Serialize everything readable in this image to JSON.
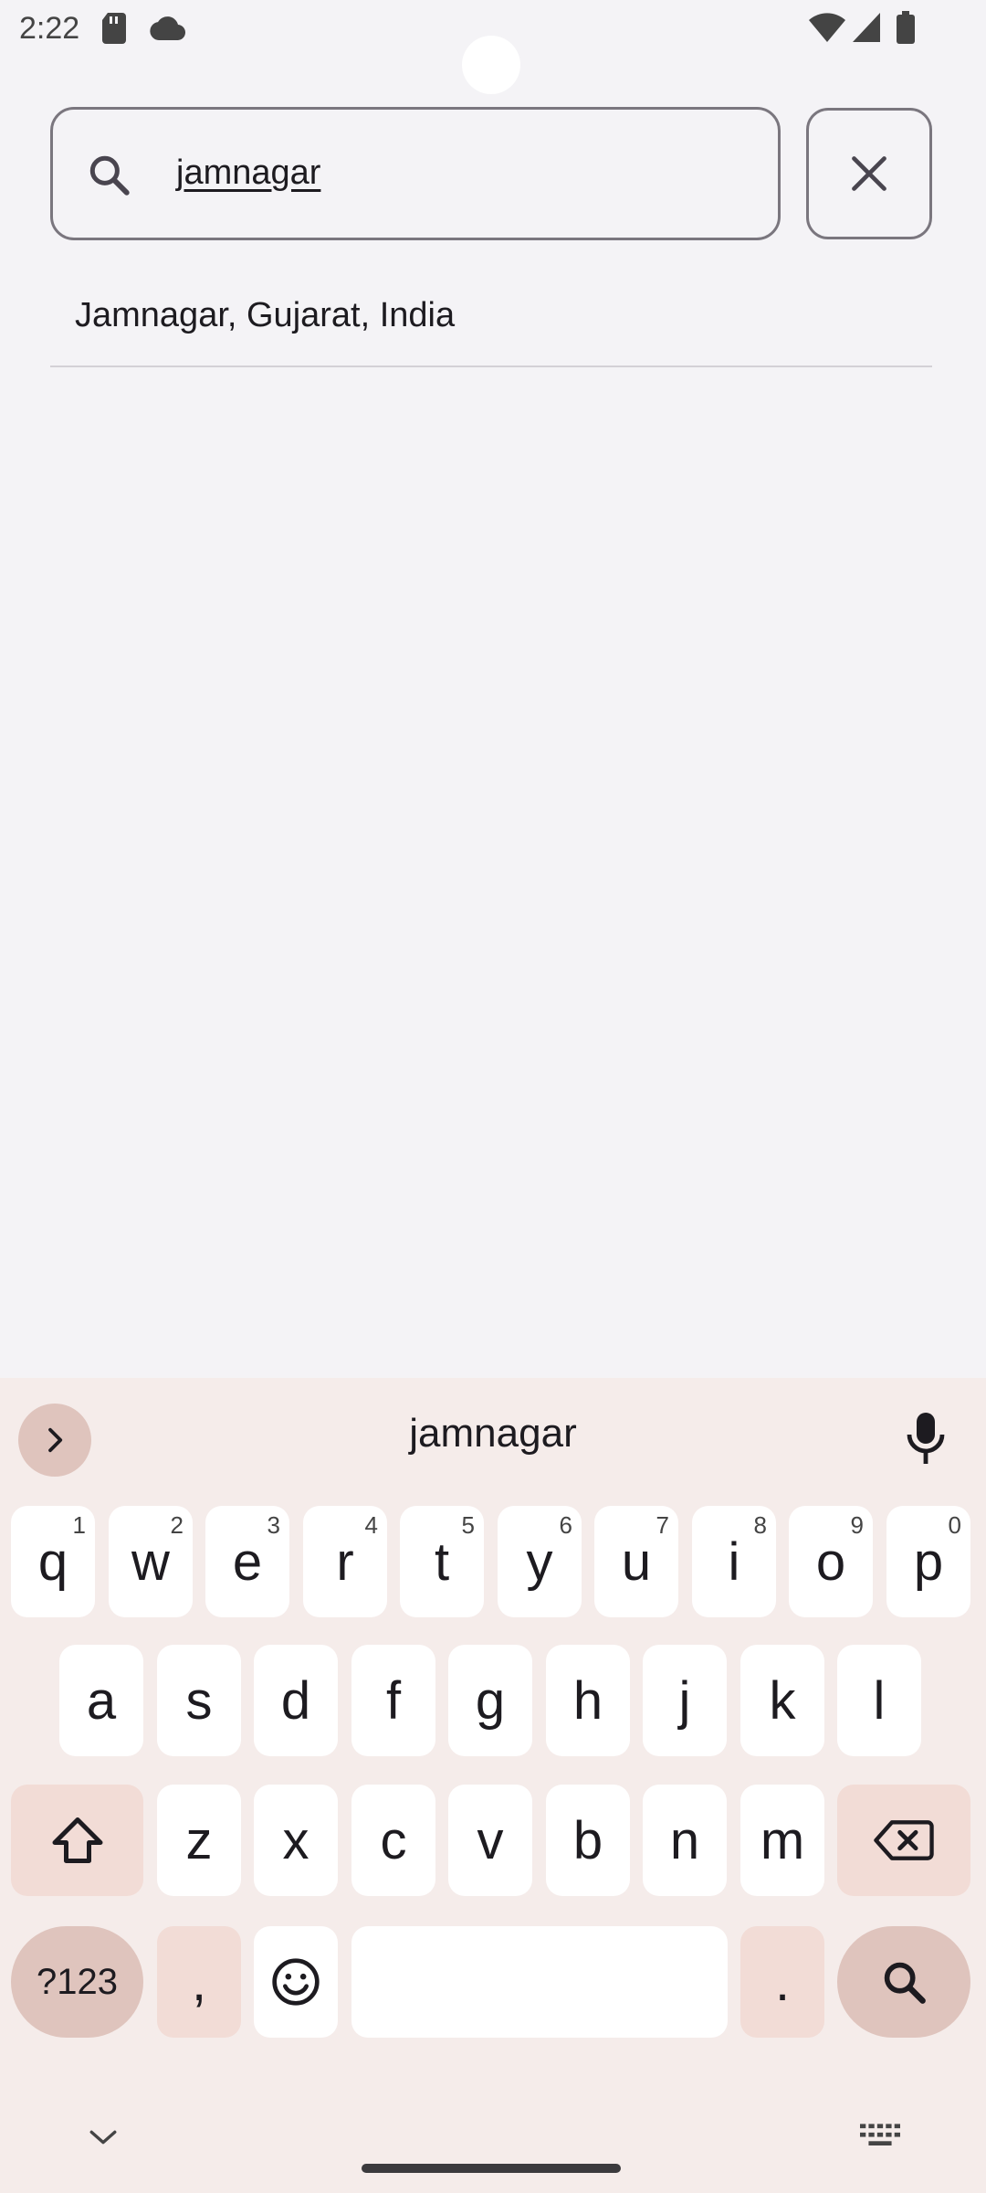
{
  "status_bar": {
    "time": "2:22"
  },
  "search": {
    "query": "jamnagar"
  },
  "suggestions": [
    "Jamnagar, Gujarat, India"
  ],
  "keyboard": {
    "suggestion": "jamnagar",
    "row1": [
      {
        "key": "q",
        "hint": "1"
      },
      {
        "key": "w",
        "hint": "2"
      },
      {
        "key": "e",
        "hint": "3"
      },
      {
        "key": "r",
        "hint": "4"
      },
      {
        "key": "t",
        "hint": "5"
      },
      {
        "key": "y",
        "hint": "6"
      },
      {
        "key": "u",
        "hint": "7"
      },
      {
        "key": "i",
        "hint": "8"
      },
      {
        "key": "o",
        "hint": "9"
      },
      {
        "key": "p",
        "hint": "0"
      }
    ],
    "row2": [
      "a",
      "s",
      "d",
      "f",
      "g",
      "h",
      "j",
      "k",
      "l"
    ],
    "row3": [
      "z",
      "x",
      "c",
      "v",
      "b",
      "n",
      "m"
    ],
    "symbols_label": "?123",
    "comma": ",",
    "period": "."
  },
  "colors": {
    "background": "#f4f3f6",
    "keyboard_bg": "#f5ecea",
    "accent_key": "#dfc4bd",
    "modifier_key": "#f2dcd6"
  },
  "icons": [
    "sd-card-icon",
    "cloud-icon",
    "wifi-icon",
    "signal-icon",
    "battery-icon",
    "search-icon",
    "close-icon",
    "chevron-right-icon",
    "mic-icon",
    "shift-icon",
    "backspace-icon",
    "emoji-icon",
    "keyboard-hide-icon",
    "keyboard-switch-icon"
  ]
}
